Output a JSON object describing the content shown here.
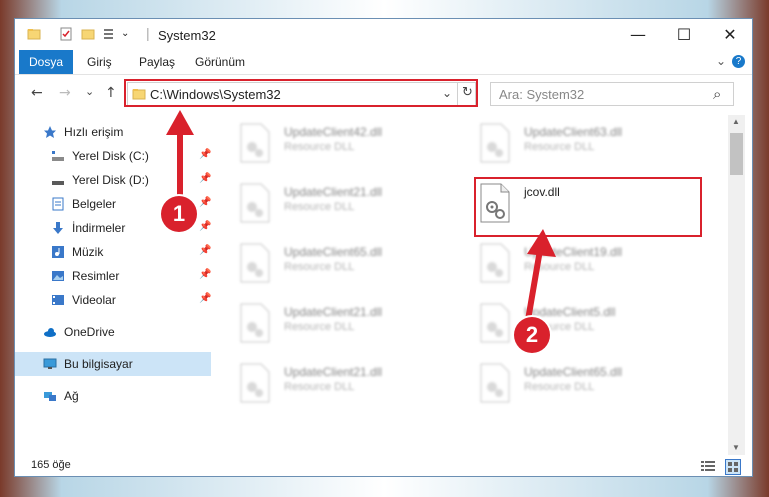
{
  "window": {
    "title": "System32",
    "minimize": "—",
    "maximize": "☐",
    "close": "✕"
  },
  "ribbon": {
    "tabs": [
      {
        "label": "Dosya",
        "active": true
      },
      {
        "label": "Giriş"
      },
      {
        "label": "Paylaş"
      },
      {
        "label": "Görünüm"
      }
    ],
    "help_icon": "?"
  },
  "toolbar": {
    "back": "←",
    "forward": "→",
    "recent": "⌄",
    "up": "↑",
    "address": "C:\\Windows\\System32",
    "dropdown": "⌄",
    "refresh": "↻",
    "search_placeholder": "Ara: System32",
    "search_icon": "⌕"
  },
  "sidebar": {
    "items": [
      {
        "label": "Hızlı erişim",
        "icon": "star-icon"
      },
      {
        "label": "Yerel Disk (C:)",
        "icon": "drive-icon",
        "pinned": true
      },
      {
        "label": "Yerel Disk (D:)",
        "icon": "drive-icon",
        "pinned": true
      },
      {
        "label": "Belgeler",
        "icon": "documents-icon",
        "pinned": true
      },
      {
        "label": "İndirmeler",
        "icon": "download-icon",
        "pinned": true
      },
      {
        "label": "Müzik",
        "icon": "music-icon",
        "pinned": true
      },
      {
        "label": "Resimler",
        "icon": "pictures-icon",
        "pinned": true
      },
      {
        "label": "Videolar",
        "icon": "videos-icon",
        "pinned": true
      },
      {
        "label": "OneDrive",
        "icon": "onedrive-icon"
      },
      {
        "label": "Bu bilgisayar",
        "icon": "computer-icon",
        "selected": true
      },
      {
        "label": "Ağ",
        "icon": "network-icon"
      }
    ],
    "pin_glyph": "📌"
  },
  "files": [
    {
      "name": "UpdateClient42.dll",
      "type": "Resource DLL",
      "blurred": true
    },
    {
      "name": "UpdateClient63.dll",
      "type": "Resource DLL",
      "blurred": true
    },
    {
      "name": "UpdateClient21.dll",
      "type": "Resource DLL",
      "blurred": true
    },
    {
      "name": "jcov.dll",
      "type": "",
      "blurred": false
    },
    {
      "name": "UpdateClient65.dll",
      "type": "Resource DLL",
      "blurred": true
    },
    {
      "name": "UpdateClient19.dll",
      "type": "Resource DLL",
      "blurred": true
    },
    {
      "name": "UpdateClient21.dll",
      "type": "Resource DLL",
      "blurred": true
    },
    {
      "name": "UpdateClient5.dll",
      "type": "Resource DLL",
      "blurred": true
    },
    {
      "name": "UpdateClient21.dll",
      "type": "Resource DLL",
      "blurred": true
    },
    {
      "name": "UpdateClient65.dll",
      "type": "Resource DLL",
      "blurred": true
    }
  ],
  "status": {
    "count": "165 öğe"
  },
  "annotations": {
    "marker1": "1",
    "marker2": "2",
    "color": "#d9212c"
  }
}
